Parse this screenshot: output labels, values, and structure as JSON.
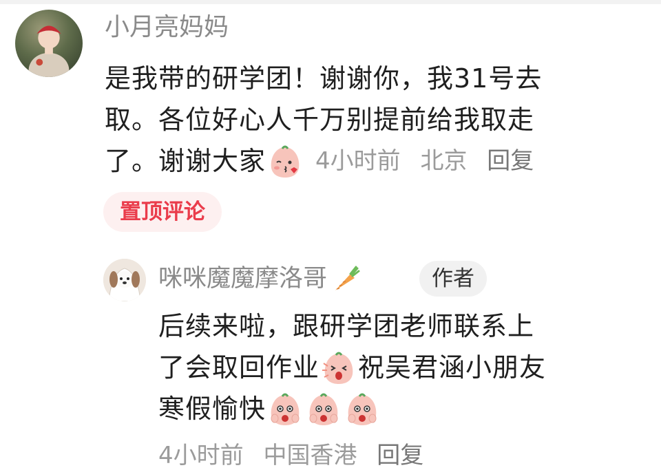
{
  "main_comment": {
    "author": "小月亮妈妈",
    "lines": [
      "是我带的研学团！谢谢你，我31号去",
      "取。各位好心人千万别提前给我取走",
      "了。谢谢大家"
    ],
    "emoji": "peach-kiss-icon",
    "time": "4小时前",
    "location": "北京",
    "reply_label": "回复",
    "pinned_label": "置顶评论"
  },
  "reply_comment": {
    "author": "咪咪魔魔摩洛哥",
    "author_badge_icon": "carrot-icon",
    "role_badge": "作者",
    "line1": "后续来啦，跟研学团老师联系上",
    "line2_a": "了会取回作业",
    "line2_b": "祝吴君涵小朋友",
    "line3": "寒假愉快",
    "emoji_line2": "peach-excited-icon",
    "emoji_line3": [
      "peach-cheer-icon",
      "peach-cheer-icon",
      "peach-cheer-icon"
    ],
    "time": "4小时前",
    "location": "中国香港",
    "reply_label": "回复"
  },
  "colors": {
    "pinned_text": "#ea3c4b",
    "pinned_bg": "#fdf0f0",
    "meta_text": "#9b9b9b",
    "body_text": "#1f1f1f"
  }
}
